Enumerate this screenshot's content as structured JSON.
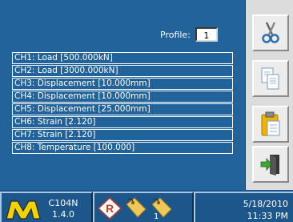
{
  "profile": {
    "label": "Profile:",
    "value": "1"
  },
  "channels": [
    "CH1: Load [500.000kN]",
    "CH2: Load [3000.000kN]",
    "CH3: Displacement [10.000mm]",
    "CH4: Displacement [10.000mm]",
    "CH5: Displacement [25.000mm]",
    "CH6: Strain [2.120]",
    "CH7: Strain [2.120]",
    "CH8: Temperature [100.000]"
  ],
  "toolbar": {
    "icons": [
      "scissors-icon",
      "copy-icon",
      "paste-icon",
      "exit-door-icon"
    ]
  },
  "status": {
    "model_line1": "C104N",
    "model_line2": "1.4.0",
    "status_icons": [
      "record-icon",
      "tag-icon",
      "tag-icon"
    ],
    "tag_count": "1",
    "date": "5/18/2010",
    "time": "11:33 PM"
  },
  "colors": {
    "panel_bg": "#21639a",
    "status_bg": "#1c568a",
    "toolbar_bg": "#dcdcdc",
    "text": "#ffffff"
  }
}
